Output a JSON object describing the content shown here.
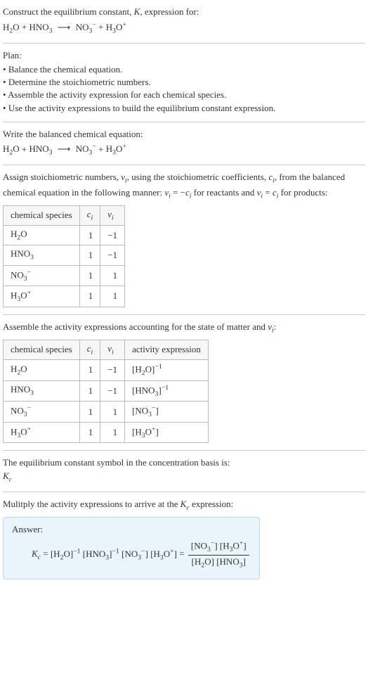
{
  "intro": {
    "line1_pre": "Construct the equilibrium constant, ",
    "line1_k": "K",
    "line1_post": ", expression for:"
  },
  "equation": {
    "r1": "H",
    "r1s": "2",
    "r1e": "O",
    "plus": " + ",
    "r2": "HNO",
    "r2s": "3",
    "arrow": "⟶",
    "p1": "NO",
    "p1s": "3",
    "p1sup": "−",
    "p2": "H",
    "p2s": "3",
    "p2e": "O",
    "p2sup": "+"
  },
  "plan": {
    "title": "Plan:",
    "items": [
      "Balance the chemical equation.",
      "Determine the stoichiometric numbers.",
      "Assemble the activity expression for each chemical species.",
      "Use the activity expressions to build the equilibrium constant expression."
    ]
  },
  "balanced_label": "Write the balanced chemical equation:",
  "stoich": {
    "line1_pre": "Assign stoichiometric numbers, ",
    "nu": "ν",
    "line1_i": "i",
    "line1_mid": ", using the stoichiometric coefficients, ",
    "c": "c",
    "line1_mid2": ", from the balanced chemical equation in the following manner: ",
    "rel_react": " = −",
    "rel_react_post": " for reactants and ",
    "rel_prod": " = ",
    "rel_prod_post": " for products:",
    "headers": {
      "species": "chemical species",
      "ci": "c",
      "nui": "ν"
    },
    "rows": [
      {
        "sp_html": "H<sub>2</sub>O",
        "c": "1",
        "nu": "−1"
      },
      {
        "sp_html": "HNO<sub>3</sub>",
        "c": "1",
        "nu": "−1"
      },
      {
        "sp_html": "NO<sub>3</sub><sup>−</sup>",
        "c": "1",
        "nu": "1"
      },
      {
        "sp_html": "H<sub>3</sub>O<sup>+</sup>",
        "c": "1",
        "nu": "1"
      }
    ]
  },
  "activity": {
    "line_pre": "Assemble the activity expressions accounting for the state of matter and ",
    "line_post": ":",
    "headers": {
      "species": "chemical species",
      "ci": "c",
      "nui": "ν",
      "act": "activity expression"
    },
    "rows": [
      {
        "sp_html": "H<sub>2</sub>O",
        "c": "1",
        "nu": "−1",
        "act_html": "[H<sub>2</sub>O]<sup>−1</sup>"
      },
      {
        "sp_html": "HNO<sub>3</sub>",
        "c": "1",
        "nu": "−1",
        "act_html": "[HNO<sub>3</sub>]<sup>−1</sup>"
      },
      {
        "sp_html": "NO<sub>3</sub><sup>−</sup>",
        "c": "1",
        "nu": "1",
        "act_html": "[NO<sub>3</sub><sup>−</sup>]"
      },
      {
        "sp_html": "H<sub>3</sub>O<sup>+</sup>",
        "c": "1",
        "nu": "1",
        "act_html": "[H<sub>3</sub>O<sup>+</sup>]"
      }
    ]
  },
  "kc_symbol": {
    "line": "The equilibrium constant symbol in the concentration basis is:",
    "k": "K",
    "sub": "c"
  },
  "multiply": {
    "line_pre": "Mulitply the activity expressions to arrive at the ",
    "line_post": " expression:"
  },
  "answer": {
    "label": "Answer:",
    "lhs_k": "K",
    "lhs_sub": "c",
    "eq": " = ",
    "expr1_html": "[H<sub>2</sub>O]<sup>−1</sup> [HNO<sub>3</sub>]<sup>−1</sup> [NO<sub>3</sub><sup>−</sup>] [H<sub>3</sub>O<sup>+</sup>]",
    "eq2": " = ",
    "frac_num_html": "[NO<sub>3</sub><sup>−</sup>] [H<sub>3</sub>O<sup>+</sup>]",
    "frac_den_html": "[H<sub>2</sub>O] [HNO<sub>3</sub>]"
  }
}
